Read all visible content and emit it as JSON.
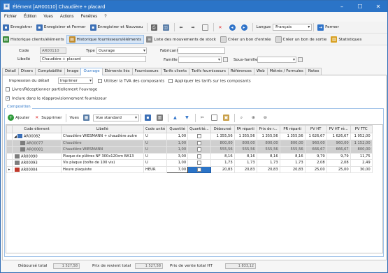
{
  "window": {
    "title": "Élément [AR00110] Chaudière + placard"
  },
  "menu": [
    "Fichier",
    "Édition",
    "Vues",
    "Actions",
    "Fenêtres",
    "?"
  ],
  "toolbar": {
    "save": "Enregistrer",
    "save_close": "Enregistrer et Fermer",
    "save_new": "Enregistrer et Nouveau",
    "language_label": "Langue",
    "language_value": "Français",
    "close": "Fermer"
  },
  "toolbar2": {
    "hist_clients": "Historique clients/éléments",
    "hist_suppliers": "Historique fournisseurs/éléments",
    "stock_moves": "Liste des mouvements de stock",
    "bon_entree": "Créer un bon d'entrée",
    "bon_sortie": "Créer un bon de sortie",
    "stats": "Statistiques"
  },
  "form": {
    "code_label": "Code",
    "code_value": "AR00110",
    "type_label": "Type",
    "type_value": "Ouvrage",
    "fabricant_label": "Fabricant",
    "fabricant_value": "",
    "libelle_label": "Libellé",
    "libelle_value": "Chaudière + placard",
    "famille_label": "Famille",
    "famille_value": "",
    "sousfamille_label": "Sous-famille",
    "sousfamille_value": ""
  },
  "tabs": [
    "Détail",
    "Divers",
    "Comptabilité",
    "Image",
    "Ouvrage",
    "Éléments liés",
    "Fournisseurs",
    "Tarifs clients",
    "Tarifs fournisseurs",
    "Références",
    "Web",
    "Métrés / Formules",
    "Notes"
  ],
  "active_tab": "Ouvrage",
  "ouvrage": {
    "impression_label": "Impression du détail",
    "impression_value": "Imprimer",
    "tva_label": "Utiliser la TVA des composants",
    "tarifs_label": "Appliquer les tarifs sur les composants",
    "livrer_label": "Livrer/Réceptionner partiellement l'ouvrage",
    "reappro_label": "Inclure dans le réapprovisionnement fournisseur"
  },
  "composition": {
    "group_label": "Composition",
    "add": "Ajouter",
    "delete": "Supprimer",
    "views_label": "Vues",
    "view_value": "Vue standard"
  },
  "grid": {
    "columns": [
      "Code élément",
      "Libellé",
      "Code unité",
      "Quantité",
      "Quantité...",
      "Déboursé",
      "PA réparti",
      "Prix de r...",
      "PR réparti",
      "PV HT",
      "PV HT ré...",
      "PV TTC"
    ],
    "rows": [
      {
        "code": "AR00082",
        "label": "Chaudière WIESMANN + chaudière autre",
        "unit": "U",
        "qty": "1,00",
        "debourse": "1 355,56",
        "pa": "1 355,56",
        "pr": "1 355,56",
        "prr": "1 355,56",
        "pvht": "1 626,67",
        "pvhtr": "1 626,67",
        "pvttc": "1 952,00",
        "level": 0,
        "type": "ouvrage"
      },
      {
        "code": "AR00077",
        "label": "Chaudière",
        "unit": "U",
        "qty": "1,00",
        "debourse": "800,00",
        "pa": "800,00",
        "pr": "800,00",
        "prr": "800,00",
        "pvht": "960,00",
        "pvhtr": "960,00",
        "pvttc": "1 152,00",
        "level": 1,
        "type": "article"
      },
      {
        "code": "AR00081",
        "label": "Chaudière WIESMANN",
        "unit": "U",
        "qty": "1,00",
        "debourse": "555,56",
        "pa": "555,56",
        "pr": "555,56",
        "prr": "555,56",
        "pvht": "666,67",
        "pvhtr": "666,67",
        "pvttc": "800,00",
        "level": 1,
        "type": "article"
      },
      {
        "code": "AR00090",
        "label": "Plaque de plâtres NF 300x120cm BA13",
        "unit": "U",
        "qty": "3,00",
        "debourse": "8,16",
        "pa": "8,16",
        "pr": "8,16",
        "prr": "8,16",
        "pvht": "9,79",
        "pvhtr": "9,79",
        "pvttc": "11,75",
        "level": 0,
        "type": "article"
      },
      {
        "code": "AR00093",
        "label": "Vis plaque (boîte de 100 vis)",
        "unit": "U",
        "qty": "1,00",
        "debourse": "1,73",
        "pa": "1,73",
        "pr": "1,73",
        "prr": "1,73",
        "pvht": "2,08",
        "pvhtr": "2,08",
        "pvttc": "2,49",
        "level": 0,
        "type": "article"
      },
      {
        "code": "AR00004",
        "label": "Heure plaquiste",
        "unit": "HEUR",
        "qty": "7,00",
        "debourse": "20,83",
        "pa": "20,83",
        "pr": "20,83",
        "prr": "20,83",
        "pvht": "25,00",
        "pvhtr": "25,00",
        "pvttc": "30,00",
        "level": 0,
        "type": "service"
      }
    ]
  },
  "totals": {
    "debourse_label": "Déboursé total",
    "debourse_value": "1 527,58",
    "revient_label": "Prix de revient total",
    "revient_value": "1 527,58",
    "vente_label": "Prix de vente total HT",
    "vente_value": "1 833,12"
  },
  "colors": {
    "titlebar": "#2b74c7",
    "accent": "#2b74c7"
  }
}
